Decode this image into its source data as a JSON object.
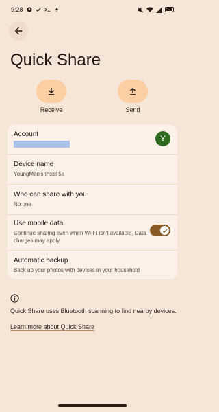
{
  "status_bar": {
    "time": "9:28",
    "left_icons": [
      "account-circle-icon",
      "check-icon",
      "terminal-icon",
      "bolt-icon"
    ],
    "right_icons": [
      "mute-icon",
      "wifi-icon",
      "signal-icon",
      "battery-icon"
    ]
  },
  "header": {
    "title": "Quick Share"
  },
  "actions": {
    "receive_label": "Receive",
    "send_label": "Send"
  },
  "settings": {
    "account_title": "Account",
    "account_avatar_letter": "Y",
    "device_title": "Device name",
    "device_value": "YoungMan's Pixel 5a",
    "who_title": "Who can share with you",
    "who_value": "No one",
    "mobile_title": "Use mobile data",
    "mobile_desc": "Continue sharing even when Wi-Fi isn't available. Data charges may apply.",
    "mobile_enabled": true,
    "backup_title": "Automatic backup",
    "backup_desc": "Back up your photos with devices in your household"
  },
  "footer": {
    "info_text": "Quick Share uses Bluetooth scanning to find nearby devices.",
    "learn_more": "Learn more about Quick Share"
  },
  "colors": {
    "background": "#f6e6d8",
    "card": "#fbf1e9",
    "action_button": "#fbcfa3",
    "toggle": "#8a5a26",
    "avatar": "#2e6b1f",
    "account_placeholder": "#a9c3ea"
  }
}
